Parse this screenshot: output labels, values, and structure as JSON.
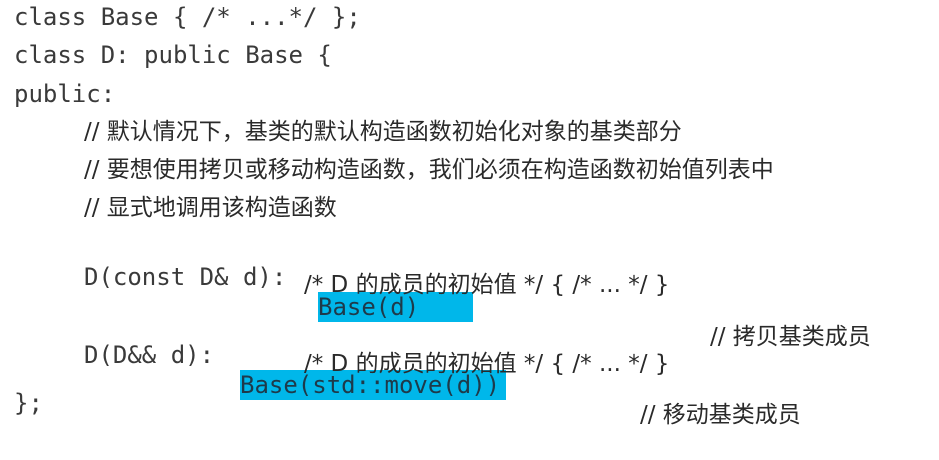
{
  "lines": {
    "l1": "class Base { /* ...*/ };",
    "l2": "class D: public Base {",
    "l3": "public:",
    "c1": "// 默认情况下，基类的默认构造函数初始化对象的基类部分",
    "c2": "// 要想使用拷贝或移动构造函数，我们必须在构造函数初始值列表中",
    "c3": "// 显式地调用该构造函数",
    "copy_ctor_sig": "D(const D& d): ",
    "copy_ctor_init": "Base(d)",
    "copy_ctor_comment": "// 拷贝基类成员",
    "copy_ctor_body": "/* D 的成员的初始值 */ { /* ... */ }",
    "move_ctor_sig": "D(D&& d): ",
    "move_ctor_init": "Base(std::move(d))",
    "move_ctor_comment": "// 移动基类成员",
    "move_ctor_body": "/* D 的成员的初始值 */ { /* ... */ }",
    "close": "};"
  },
  "colors": {
    "highlight": "#00b7ea",
    "text": "#3a3a3a"
  }
}
